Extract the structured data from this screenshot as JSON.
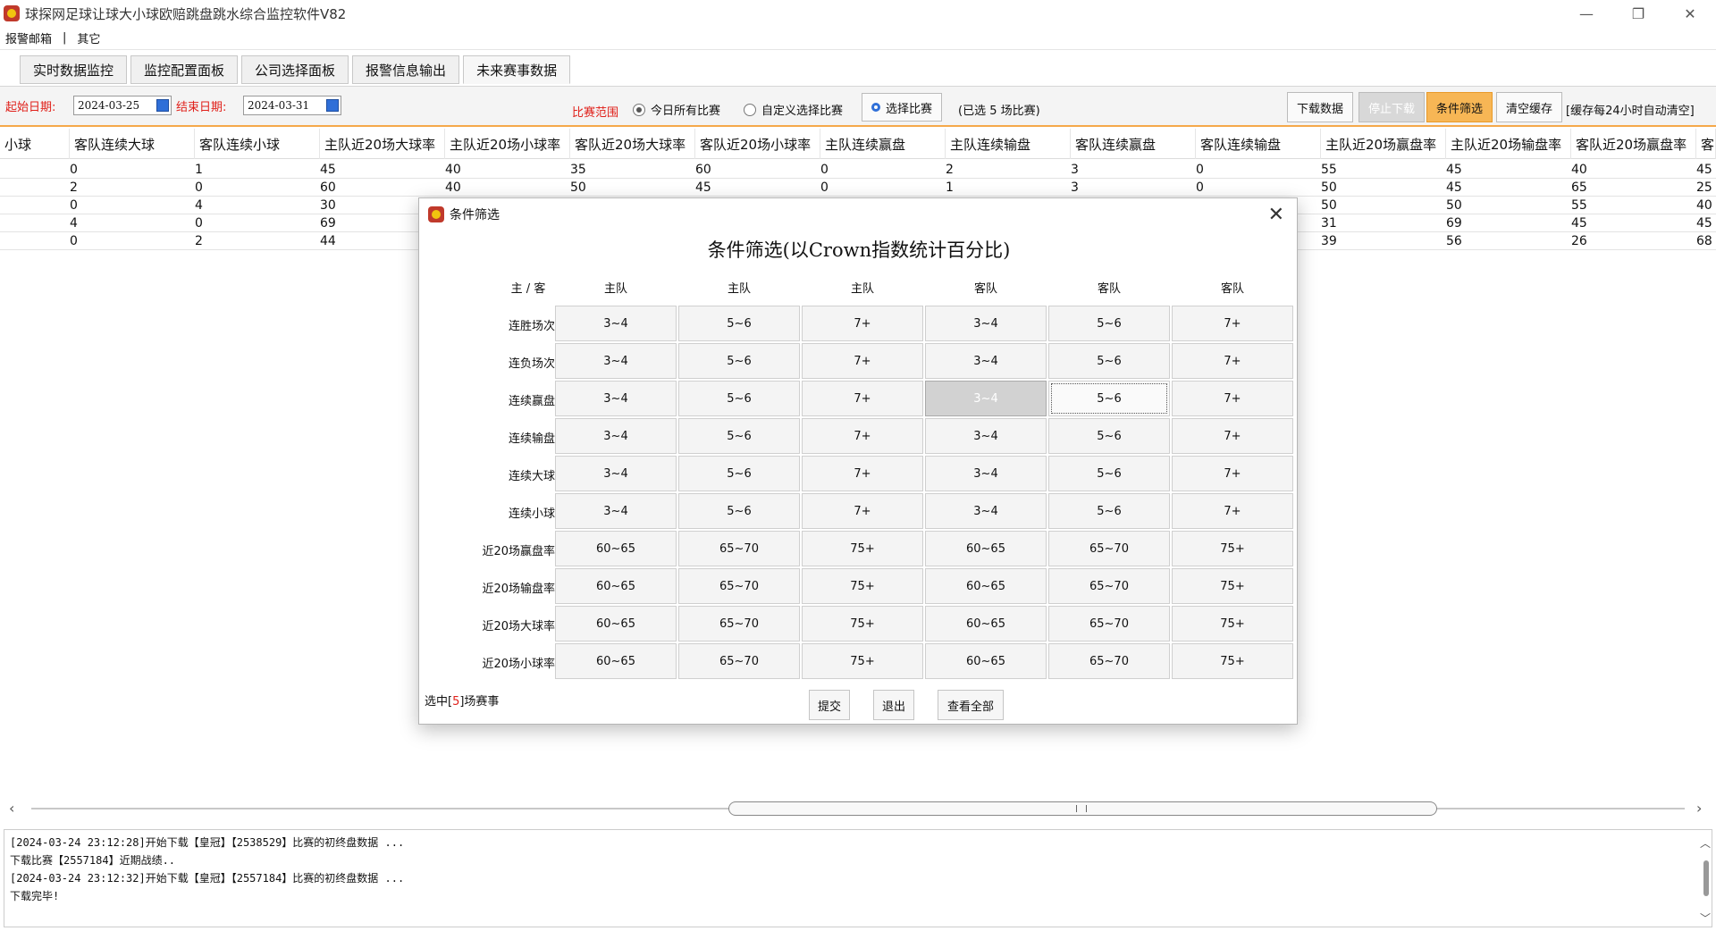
{
  "window": {
    "title": "球探网足球让球大小球欧赔跳盘跳水综合监控软件V82",
    "minimize": "—",
    "restore": "❐",
    "close": "✕"
  },
  "menu": {
    "items": [
      "报警邮箱",
      "|",
      "其它"
    ]
  },
  "tabs": [
    {
      "label": "实时数据监控",
      "active": false
    },
    {
      "label": "监控配置面板",
      "active": false
    },
    {
      "label": "公司选择面板",
      "active": false
    },
    {
      "label": "报警信息输出",
      "active": false
    },
    {
      "label": "未来赛事数据",
      "active": true
    }
  ],
  "toolbar": {
    "start_label": "起始日期:",
    "start_date": "2024-03-25",
    "end_label": "结束日期:",
    "end_date": "2024-03-31",
    "range_label": "比赛范围",
    "radio_today": "今日所有比赛",
    "radio_custom": "自定义选择比赛",
    "select_button": "选择比赛",
    "selected_info": "(已选 5 场比赛)",
    "download_button": "下载数据",
    "stop_button": "停止下载",
    "filter_button": "条件筛选",
    "clear_cache_button": "清空缓存",
    "cache_note": "[缓存每24小时自动清空]"
  },
  "grid": {
    "columns": [
      "小球",
      "客队连续大球",
      "客队连续小球",
      "主队近20场大球率",
      "主队近20场小球率",
      "客队近20场大球率",
      "客队近20场小球率",
      "主队连续赢盘",
      "主队连续输盘",
      "客队连续赢盘",
      "客队连续输盘",
      "主队近20场赢盘率",
      "主队近20场输盘率",
      "客队近20场赢盘率",
      "客"
    ],
    "rows": [
      [
        "0",
        "1",
        "45",
        "40",
        "35",
        "60",
        "0",
        "2",
        "3",
        "0",
        "55",
        "45",
        "40",
        "45"
      ],
      [
        "2",
        "0",
        "60",
        "40",
        "50",
        "45",
        "0",
        "1",
        "3",
        "0",
        "50",
        "45",
        "65",
        "25"
      ],
      [
        "0",
        "4",
        "30",
        "",
        "",
        "",
        "",
        "",
        "",
        "",
        "50",
        "50",
        "55",
        "40"
      ],
      [
        "4",
        "0",
        "69",
        "",
        "",
        "",
        "",
        "",
        "",
        "",
        "31",
        "69",
        "45",
        "45"
      ],
      [
        "0",
        "2",
        "44",
        "",
        "",
        "",
        "",
        "",
        "",
        "",
        "39",
        "56",
        "26",
        "68"
      ]
    ]
  },
  "log": {
    "lines": [
      "[2024-03-24 23:12:28]开始下载【皇冠】【2538529】比赛的初终盘数据 ...",
      "下载比赛【2557184】近期战绩..",
      "[2024-03-24 23:12:32]开始下载【皇冠】【2557184】比赛的初终盘数据 ...",
      "下载完毕!"
    ]
  },
  "scroll": {
    "left": "‹",
    "right": "›",
    "up": "︿",
    "down": "﹀"
  },
  "dialog": {
    "title": "条件筛选",
    "close": "✕",
    "heading": "条件筛选(以Crown指数统计百分比)",
    "corner_header": "主 / 客",
    "col_headers": [
      "主队",
      "主队",
      "主队",
      "客队",
      "客队",
      "客队"
    ],
    "rows": [
      {
        "label": "连胜场次",
        "options": [
          "3~4",
          "5~6",
          "7+",
          "3~4",
          "5~6",
          "7+"
        ]
      },
      {
        "label": "连负场次",
        "options": [
          "3~4",
          "5~6",
          "7+",
          "3~4",
          "5~6",
          "7+"
        ]
      },
      {
        "label": "连续赢盘",
        "options": [
          "3~4",
          "5~6",
          "7+",
          "3~4",
          "5~6",
          "7+"
        ]
      },
      {
        "label": "连续输盘",
        "options": [
          "3~4",
          "5~6",
          "7+",
          "3~4",
          "5~6",
          "7+"
        ]
      },
      {
        "label": "连续大球",
        "options": [
          "3~4",
          "5~6",
          "7+",
          "3~4",
          "5~6",
          "7+"
        ]
      },
      {
        "label": "连续小球",
        "options": [
          "3~4",
          "5~6",
          "7+",
          "3~4",
          "5~6",
          "7+"
        ]
      },
      {
        "label": "近20场赢盘率",
        "options": [
          "60~65",
          "65~70",
          "75+",
          "60~65",
          "65~70",
          "75+"
        ]
      },
      {
        "label": "近20场输盘率",
        "options": [
          "60~65",
          "65~70",
          "75+",
          "60~65",
          "65~70",
          "75+"
        ]
      },
      {
        "label": "近20场大球率",
        "options": [
          "60~65",
          "65~70",
          "75+",
          "60~65",
          "65~70",
          "75+"
        ]
      },
      {
        "label": "近20场小球率",
        "options": [
          "60~65",
          "65~70",
          "75+",
          "60~65",
          "65~70",
          "75+"
        ]
      }
    ],
    "pressed": {
      "row": 2,
      "col": 3
    },
    "focused": {
      "row": 2,
      "col": 4
    },
    "footer_prefix": "选中[",
    "footer_count": "5",
    "footer_suffix": "]场赛事",
    "submit_button": "提交",
    "exit_button": "退出",
    "view_all_button": "查看全部"
  }
}
